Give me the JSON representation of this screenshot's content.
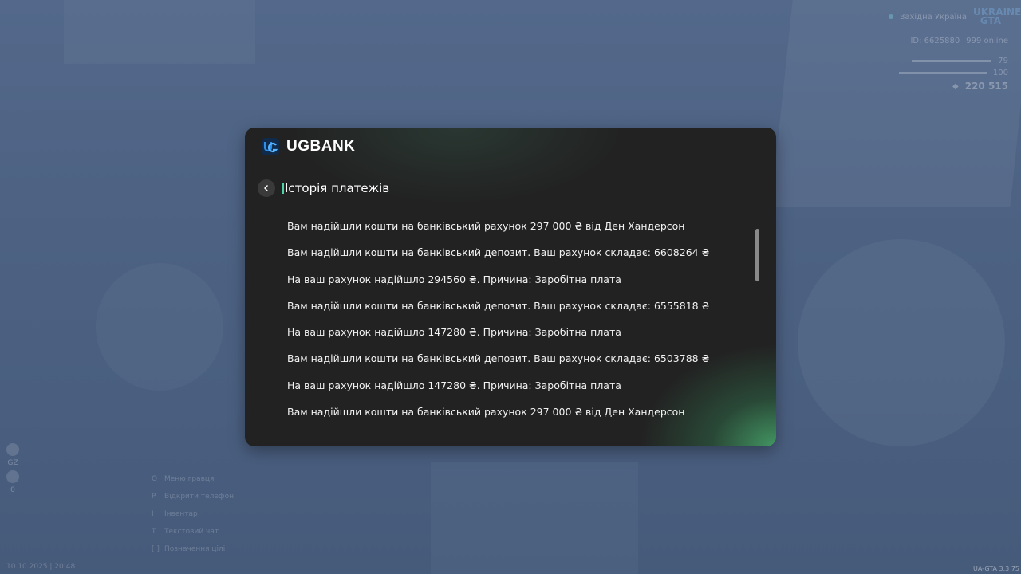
{
  "hud": {
    "status": "Західна Україна",
    "brand": "UKRAINE GTA",
    "id_label": "ID: 6625880",
    "online": "999 online",
    "money": "220 515",
    "stat_a": "79",
    "stat_b": "100",
    "side_a": "GZ",
    "side_b": "0",
    "datetime": "10.10.2025 | 20:48",
    "version": "UA-GTA 3.3",
    "version_num": "75",
    "keys": [
      {
        "key": "O",
        "label": "Меню гравця"
      },
      {
        "key": "P",
        "label": "Відкрити телефон"
      },
      {
        "key": "I",
        "label": "Інвентар"
      },
      {
        "key": "T",
        "label": "Текстовий чат"
      },
      {
        "key": "[ ]",
        "label": "Позначення цілі"
      }
    ]
  },
  "bank": {
    "name": "UGBANK",
    "page_title": "Історія платежів",
    "accent_color": "#4fd1a5",
    "transactions": [
      "Вам надійшли кошти на банківський рахунок 297 000 ₴ від Ден Хандерсон",
      "Вам надійшли кошти на банківський депозит. Ваш рахунок складає: 6608264 ₴",
      "На ваш рахунок надійшло 294560 ₴. Причина: Заробітна плата",
      "Вам надійшли кошти на банківський депозит. Ваш рахунок складає: 6555818 ₴",
      "На ваш рахунок надійшло 147280 ₴. Причина: Заробітна плата",
      "Вам надійшли кошти на банківський депозит. Ваш рахунок складає: 6503788 ₴",
      "На ваш рахунок надійшло 147280 ₴. Причина: Заробітна плата",
      "Вам надійшли кошти на банківський рахунок 297 000 ₴ від Ден Хандерсон"
    ]
  }
}
